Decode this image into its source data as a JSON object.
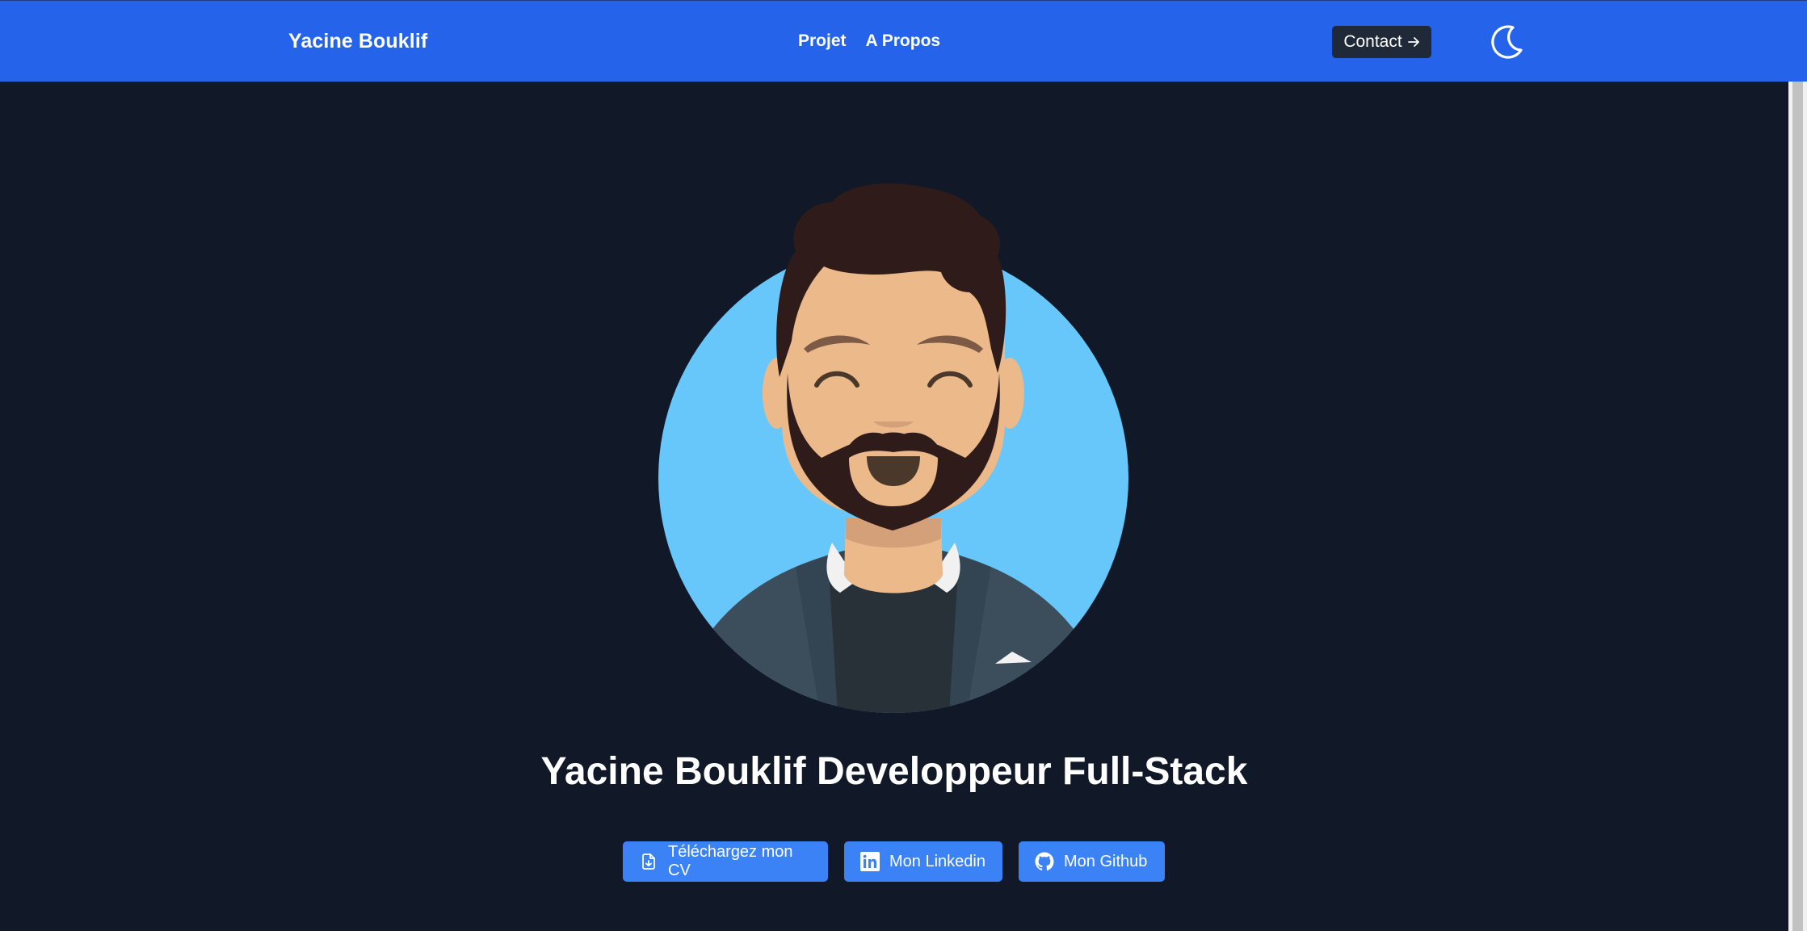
{
  "navbar": {
    "brand": "Yacine Bouklif",
    "links": [
      "Projet",
      "A Propos"
    ],
    "contact_label": "Contact",
    "contact_icon": "arrow-right-icon",
    "theme_icon": "moon-icon"
  },
  "hero": {
    "avatar": "avatar-illustration",
    "title": "Yacine Bouklif Developpeur Full-Stack",
    "buttons": [
      {
        "label": "Téléchargez mon CV",
        "icon": "file-download-icon"
      },
      {
        "label": "Mon Linkedin",
        "icon": "linkedin-icon"
      },
      {
        "label": "Mon Github",
        "icon": "github-icon"
      }
    ]
  },
  "colors": {
    "navbar": "#2563eb",
    "background": "#111827",
    "button": "#3b82f6",
    "contact_button": "#1f2937",
    "avatar_circle": "#67c7fb"
  }
}
